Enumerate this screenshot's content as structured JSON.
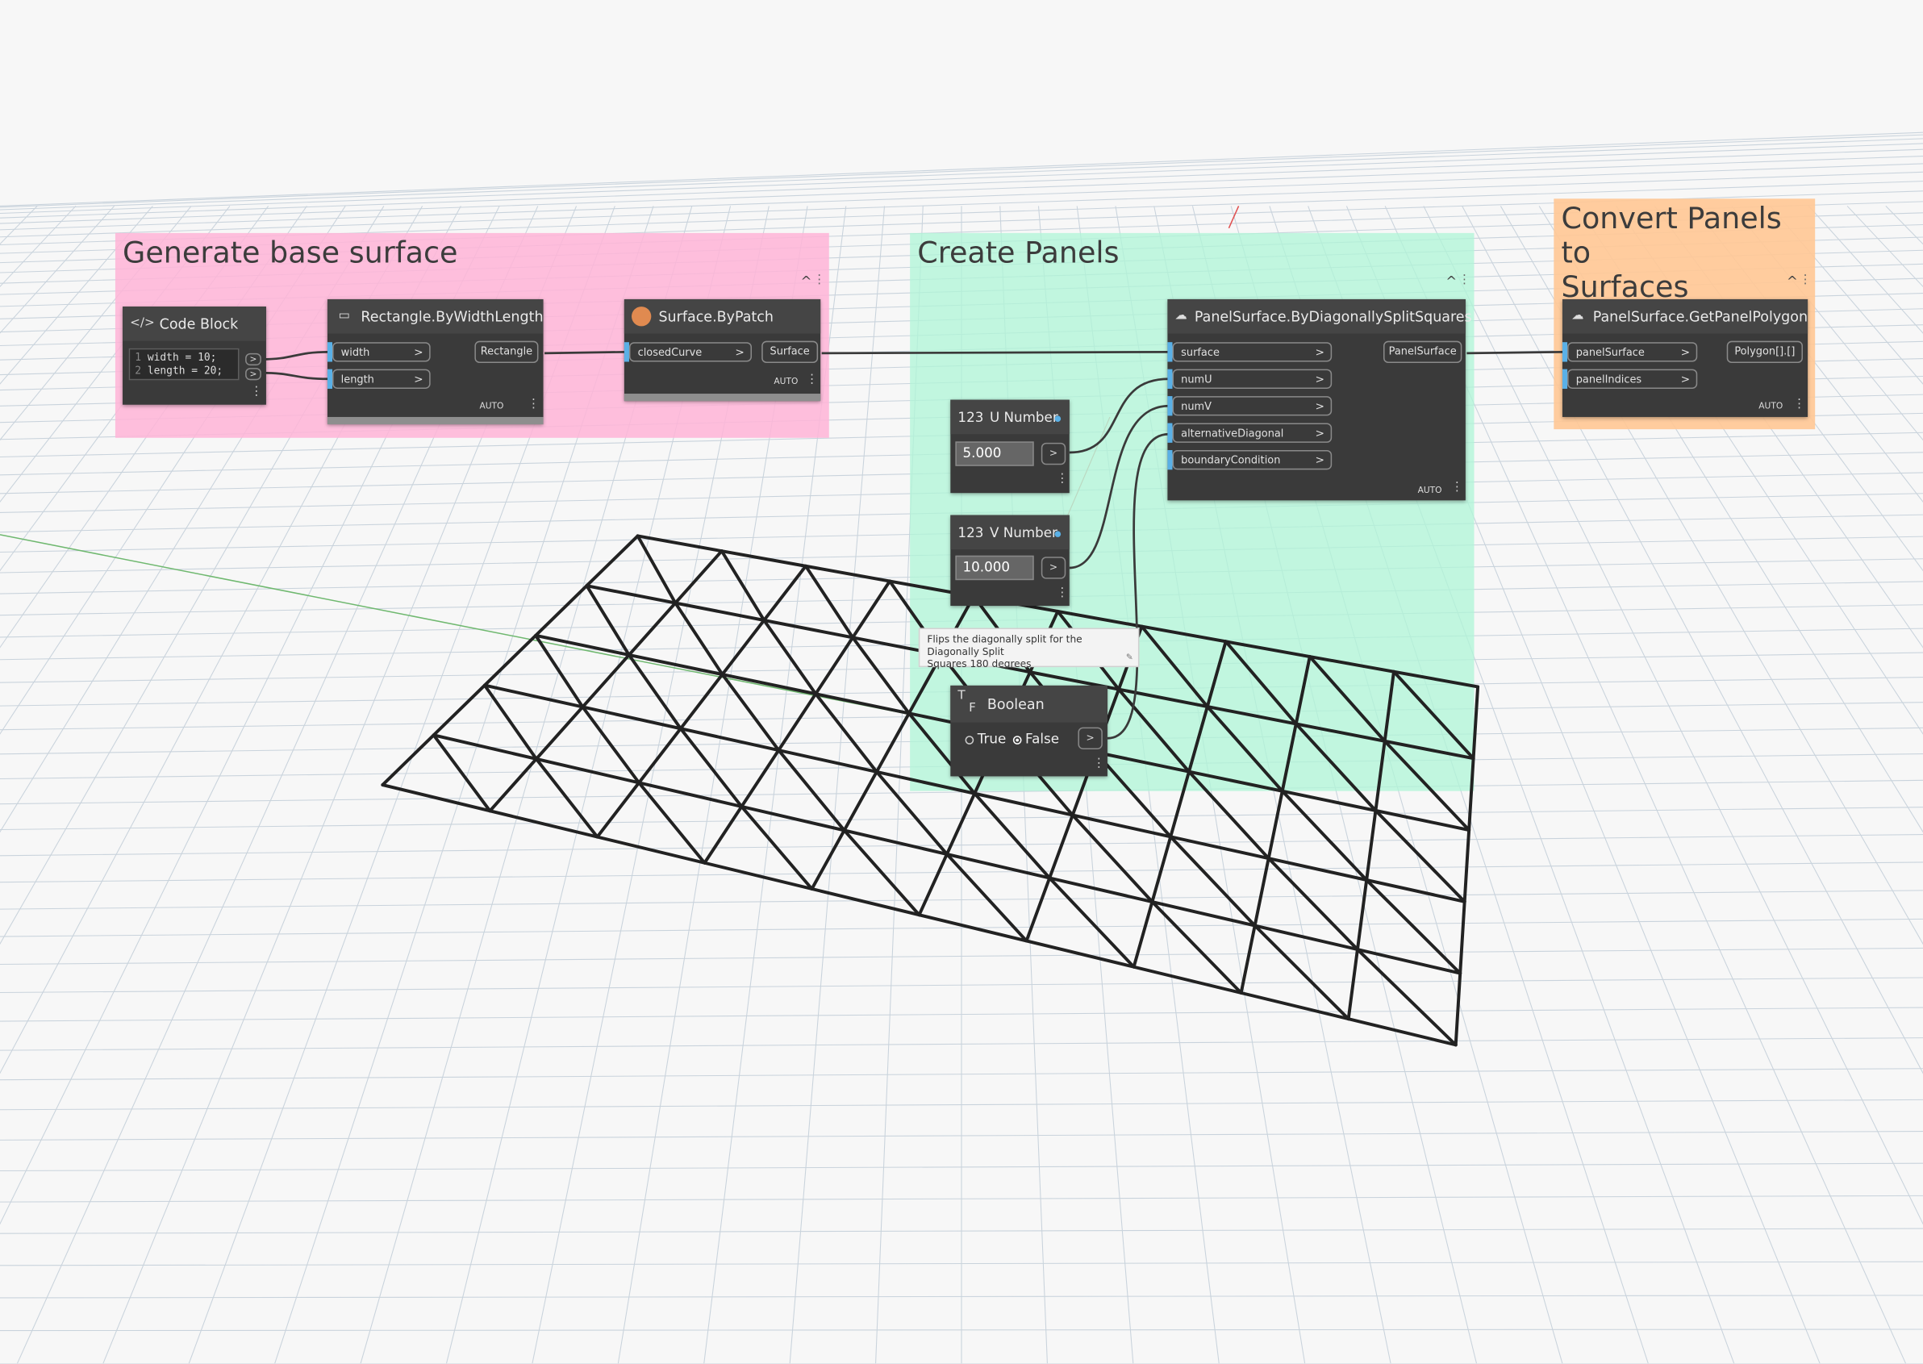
{
  "groups": {
    "base": {
      "title": "Generate base surface",
      "color": "#ffb8d8"
    },
    "panels": {
      "title": "Create Panels",
      "color": "#b6f5dc"
    },
    "convert": {
      "title_line1": "Convert Panels to",
      "title_line2": "Surfaces",
      "color": "#ffc996"
    }
  },
  "nodes": {
    "code_block": {
      "title": "Code Block",
      "icon": "code-icon",
      "line1_num": "1",
      "line1": "width = 10;",
      "line2_num": "2",
      "line2": "length = 20;",
      "out1": ">",
      "out2": ">"
    },
    "rectangle": {
      "title": "Rectangle.ByWidthLength",
      "icon": "rectangle-icon",
      "in_width": "width",
      "in_length": "length",
      "output": "Rectangle",
      "lacing": "AUTO"
    },
    "surface_patch": {
      "title": "Surface.ByPatch",
      "icon": "surface-icon",
      "in_curve": "closedCurve",
      "output": "Surface",
      "lacing": "AUTO"
    },
    "u_number": {
      "badge": "123",
      "title": "U Number",
      "value": "5.000",
      "out": ">"
    },
    "v_number": {
      "badge": "123",
      "title": "V Number",
      "value": "10.000",
      "out": ">"
    },
    "boolean": {
      "badge_t": "T",
      "badge_f": "F",
      "title": "Boolean",
      "opt_true": "True",
      "opt_false": "False",
      "selected": "False",
      "out": ">"
    },
    "panel_surface": {
      "title": "PanelSurface.ByDiagonallySplitSquares",
      "icon": "panel-icon",
      "inputs": [
        "surface",
        "numU",
        "numV",
        "alternativeDiagonal",
        "boundaryCondition"
      ],
      "output": "PanelSurface",
      "lacing": "AUTO"
    },
    "get_polygon": {
      "title": "PanelSurface.GetPanelPolygon",
      "icon": "panel-icon",
      "inputs": [
        "panelSurface",
        "panelIndices"
      ],
      "output": "Polygon[].[]",
      "lacing": "AUTO"
    }
  },
  "tooltip": {
    "line1": "Flips the diagonally split for the Diagonally Split",
    "line2": "Squares 180 degrees"
  },
  "colors": {
    "node_body": "#3a3a3a",
    "port_accent": "#5ab0e6",
    "wire": "#333333",
    "mesh": "#222222"
  }
}
